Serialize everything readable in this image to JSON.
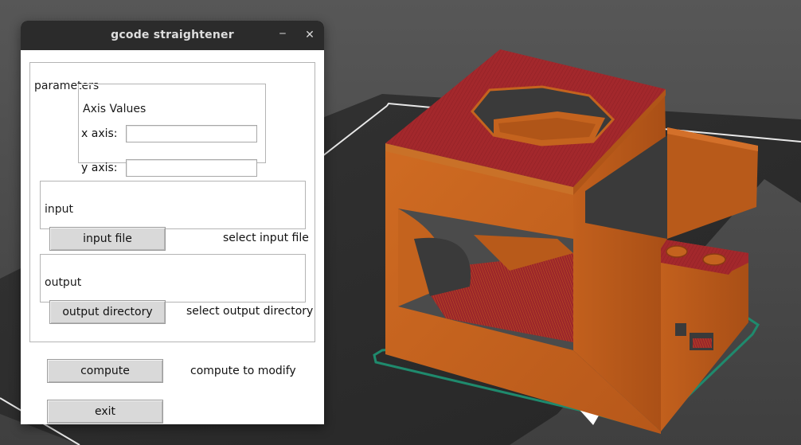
{
  "window": {
    "title": "gcode straightener",
    "minimize_glyph": "‒",
    "close_glyph": "✕"
  },
  "parameters": {
    "label": "parameters",
    "axis_values": {
      "label": "Axis Values",
      "x_label": "x axis:",
      "x_value": "",
      "y_label": "y axis:",
      "y_value": ""
    },
    "input": {
      "label": "input",
      "button_label": "input file",
      "status": "select input file"
    },
    "output": {
      "label": "output",
      "button_label": "output directory",
      "status": "select output directory"
    }
  },
  "compute": {
    "button_label": "compute",
    "status": "compute to modify"
  },
  "exit": {
    "button_label": "exit"
  },
  "viewport": {
    "background_color": "#4e4e4e",
    "bed_color": "#2e2e2e",
    "model_color": "#c4631e",
    "top_surface_color": "#a5292d",
    "skirt_color": "#1f8a6d"
  }
}
